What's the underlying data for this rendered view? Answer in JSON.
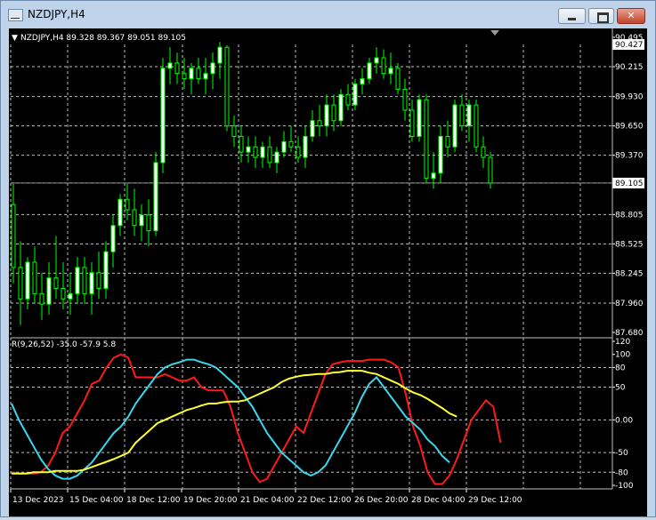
{
  "window": {
    "title": "NZDJPY,H4",
    "controls": {
      "minimize": "▁",
      "maximize": "□",
      "close": "✕"
    }
  },
  "chart_header": {
    "arrow": "▼",
    "symbol_info": "NZDJPY,H4  89.328 89.367 89.051 89.105"
  },
  "indicator_header": "R(9,26,52) -35.0 -57.9 5.8",
  "price_labels": {
    "bid_tag": "90.427",
    "current_tag": "89.105"
  },
  "colors": {
    "background": "#000000",
    "grid": "#bfbfbf",
    "candle": "#00ff00",
    "candle_fill": "#ffffff",
    "line_red": "#ff1a1a",
    "line_cyan": "#39d8ee",
    "line_yellow": "#ffff33"
  },
  "chart_data": [
    {
      "type": "candlestick",
      "title": "NZDJPY,H4",
      "ylim": [
        87.68,
        90.495
      ],
      "y_ticks": [
        "90.495",
        "90.215",
        "89.930",
        "89.650",
        "89.370",
        "89.105",
        "88.805",
        "88.525",
        "88.245",
        "87.960",
        "87.680"
      ],
      "current_price": 89.105,
      "candles": [
        {
          "o": 88.9,
          "h": 89.1,
          "l": 88.15,
          "c": 88.3
        },
        {
          "o": 88.3,
          "h": 88.55,
          "l": 87.75,
          "c": 88.0
        },
        {
          "o": 88.0,
          "h": 88.4,
          "l": 87.9,
          "c": 88.35
        },
        {
          "o": 88.35,
          "h": 88.5,
          "l": 87.95,
          "c": 88.05
        },
        {
          "o": 88.05,
          "h": 88.25,
          "l": 87.8,
          "c": 87.95
        },
        {
          "o": 87.95,
          "h": 88.35,
          "l": 87.85,
          "c": 88.2
        },
        {
          "o": 88.2,
          "h": 88.6,
          "l": 88.0,
          "c": 88.1
        },
        {
          "o": 88.1,
          "h": 88.35,
          "l": 87.9,
          "c": 88.0
        },
        {
          "o": 88.0,
          "h": 88.25,
          "l": 87.85,
          "c": 88.05
        },
        {
          "o": 88.05,
          "h": 88.4,
          "l": 87.95,
          "c": 88.3
        },
        {
          "o": 88.3,
          "h": 88.4,
          "l": 87.95,
          "c": 88.05
        },
        {
          "o": 88.05,
          "h": 88.35,
          "l": 87.85,
          "c": 88.25
        },
        {
          "o": 88.25,
          "h": 88.45,
          "l": 88.0,
          "c": 88.1
        },
        {
          "o": 88.1,
          "h": 88.55,
          "l": 88.0,
          "c": 88.45
        },
        {
          "o": 88.45,
          "h": 88.8,
          "l": 88.3,
          "c": 88.7
        },
        {
          "o": 88.7,
          "h": 89.0,
          "l": 88.6,
          "c": 88.95
        },
        {
          "o": 88.95,
          "h": 89.1,
          "l": 88.75,
          "c": 88.85
        },
        {
          "o": 88.85,
          "h": 89.05,
          "l": 88.6,
          "c": 88.7
        },
        {
          "o": 88.7,
          "h": 88.9,
          "l": 88.55,
          "c": 88.8
        },
        {
          "o": 88.8,
          "h": 88.95,
          "l": 88.5,
          "c": 88.65
        },
        {
          "o": 88.65,
          "h": 89.4,
          "l": 88.6,
          "c": 89.3
        },
        {
          "o": 89.3,
          "h": 90.3,
          "l": 89.2,
          "c": 90.2
        },
        {
          "o": 90.2,
          "h": 90.4,
          "l": 90.05,
          "c": 90.25
        },
        {
          "o": 90.25,
          "h": 90.35,
          "l": 90.05,
          "c": 90.15
        },
        {
          "o": 90.15,
          "h": 90.3,
          "l": 90.0,
          "c": 90.1
        },
        {
          "o": 90.1,
          "h": 90.25,
          "l": 89.95,
          "c": 90.2
        },
        {
          "o": 90.2,
          "h": 90.3,
          "l": 90.05,
          "c": 90.1
        },
        {
          "o": 90.1,
          "h": 90.3,
          "l": 89.95,
          "c": 90.15
        },
        {
          "o": 90.15,
          "h": 90.35,
          "l": 90.0,
          "c": 90.25
        },
        {
          "o": 90.25,
          "h": 90.45,
          "l": 90.1,
          "c": 90.4
        },
        {
          "o": 90.4,
          "h": 90.42,
          "l": 89.6,
          "c": 89.65
        },
        {
          "o": 89.65,
          "h": 89.75,
          "l": 89.45,
          "c": 89.55
        },
        {
          "o": 89.55,
          "h": 89.65,
          "l": 89.3,
          "c": 89.4
        },
        {
          "o": 89.4,
          "h": 89.55,
          "l": 89.3,
          "c": 89.45
        },
        {
          "o": 89.45,
          "h": 89.55,
          "l": 89.25,
          "c": 89.35
        },
        {
          "o": 89.35,
          "h": 89.5,
          "l": 89.25,
          "c": 89.45
        },
        {
          "o": 89.45,
          "h": 89.55,
          "l": 89.25,
          "c": 89.3
        },
        {
          "o": 89.3,
          "h": 89.45,
          "l": 89.2,
          "c": 89.4
        },
        {
          "o": 89.4,
          "h": 89.6,
          "l": 89.35,
          "c": 89.5
        },
        {
          "o": 89.5,
          "h": 89.65,
          "l": 89.4,
          "c": 89.45
        },
        {
          "o": 89.45,
          "h": 89.55,
          "l": 89.3,
          "c": 89.35
        },
        {
          "o": 89.35,
          "h": 89.65,
          "l": 89.25,
          "c": 89.55
        },
        {
          "o": 89.55,
          "h": 89.8,
          "l": 89.5,
          "c": 89.7
        },
        {
          "o": 89.7,
          "h": 89.85,
          "l": 89.55,
          "c": 89.65
        },
        {
          "o": 89.65,
          "h": 89.95,
          "l": 89.55,
          "c": 89.85
        },
        {
          "o": 89.85,
          "h": 89.95,
          "l": 89.6,
          "c": 89.7
        },
        {
          "o": 89.7,
          "h": 90.0,
          "l": 89.65,
          "c": 89.95
        },
        {
          "o": 89.95,
          "h": 90.05,
          "l": 89.8,
          "c": 89.85
        },
        {
          "o": 89.85,
          "h": 90.1,
          "l": 89.8,
          "c": 90.05
        },
        {
          "o": 90.05,
          "h": 90.2,
          "l": 89.95,
          "c": 90.1
        },
        {
          "o": 90.1,
          "h": 90.3,
          "l": 90.05,
          "c": 90.25
        },
        {
          "o": 90.25,
          "h": 90.4,
          "l": 90.15,
          "c": 90.3
        },
        {
          "o": 90.3,
          "h": 90.38,
          "l": 90.1,
          "c": 90.15
        },
        {
          "o": 90.15,
          "h": 90.35,
          "l": 90.05,
          "c": 90.2
        },
        {
          "o": 90.2,
          "h": 90.25,
          "l": 89.95,
          "c": 90.0
        },
        {
          "o": 90.0,
          "h": 90.1,
          "l": 89.7,
          "c": 89.8
        },
        {
          "o": 89.8,
          "h": 89.9,
          "l": 89.5,
          "c": 89.55
        },
        {
          "o": 89.55,
          "h": 89.95,
          "l": 89.5,
          "c": 89.9
        },
        {
          "o": 89.9,
          "h": 89.95,
          "l": 89.1,
          "c": 89.15
        },
        {
          "o": 89.15,
          "h": 89.4,
          "l": 89.05,
          "c": 89.2
        },
        {
          "o": 89.2,
          "h": 89.65,
          "l": 89.1,
          "c": 89.55
        },
        {
          "o": 89.55,
          "h": 89.7,
          "l": 89.35,
          "c": 89.45
        },
        {
          "o": 89.45,
          "h": 89.9,
          "l": 89.4,
          "c": 89.85
        },
        {
          "o": 89.85,
          "h": 89.95,
          "l": 89.6,
          "c": 89.65
        },
        {
          "o": 89.65,
          "h": 89.9,
          "l": 89.5,
          "c": 89.85
        },
        {
          "o": 89.85,
          "h": 89.9,
          "l": 89.4,
          "c": 89.45
        },
        {
          "o": 89.45,
          "h": 89.55,
          "l": 89.25,
          "c": 89.35
        },
        {
          "o": 89.35,
          "h": 89.4,
          "l": 89.051,
          "c": 89.105
        }
      ]
    },
    {
      "type": "line",
      "title": "R(9,26,52) -35.0 -57.9 5.8",
      "ylim": [
        -100,
        120
      ],
      "y_ticks": [
        "120",
        "100",
        "80",
        "50",
        "0.00",
        "-50",
        "-80",
        "-100"
      ],
      "x_tick_labels": [
        "13 Dec 2023",
        "15 Dec 04:00",
        "18 Dec 12:00",
        "19 Dec 20:00",
        "21 Dec 04:00",
        "22 Dec 12:00",
        "26 Dec 20:00",
        "28 Dec 04:00",
        "29 Dec 12:00"
      ],
      "series": [
        {
          "color_key": "line_red",
          "values": [
            -80,
            -82,
            -82,
            -82,
            -80,
            -70,
            -50,
            -20,
            -10,
            10,
            30,
            55,
            60,
            80,
            95,
            100,
            95,
            65,
            65,
            65,
            65,
            70,
            65,
            60,
            60,
            65,
            50,
            45,
            45,
            45,
            20,
            -20,
            -50,
            -80,
            -95,
            -90,
            -70,
            -50,
            -30,
            -10,
            -20,
            10,
            40,
            70,
            85,
            88,
            90,
            90,
            90,
            92,
            92,
            92,
            88,
            80,
            40,
            -10,
            -40,
            -80,
            -98,
            -98,
            -85,
            -60,
            -30,
            0,
            15,
            30,
            20,
            -35
          ]
        },
        {
          "color_key": "line_cyan",
          "values": [
            25,
            0,
            -20,
            -40,
            -60,
            -75,
            -85,
            -90,
            -90,
            -85,
            -75,
            -65,
            -50,
            -35,
            -20,
            -10,
            5,
            25,
            40,
            55,
            70,
            80,
            85,
            88,
            92,
            92,
            88,
            85,
            80,
            70,
            60,
            50,
            35,
            20,
            0,
            -20,
            -35,
            -50,
            -60,
            -70,
            -80,
            -85,
            -80,
            -70,
            -50,
            -30,
            -10,
            10,
            35,
            55,
            65,
            50,
            35,
            20,
            5,
            -5,
            -15,
            -30,
            -40,
            -55,
            -65
          ]
        },
        {
          "color_key": "line_yellow",
          "values": [
            -82,
            -82,
            -82,
            -80,
            -80,
            -80,
            -78,
            -78,
            -78,
            -78,
            -76,
            -72,
            -68,
            -64,
            -60,
            -55,
            -50,
            -35,
            -25,
            -15,
            -5,
            0,
            5,
            10,
            15,
            18,
            22,
            25,
            25,
            27,
            28,
            28,
            30,
            35,
            40,
            45,
            50,
            58,
            63,
            66,
            68,
            69,
            70,
            70,
            72,
            73,
            75,
            75,
            75,
            72,
            70,
            65,
            60,
            55,
            48,
            42,
            38,
            32,
            25,
            18,
            10,
            5
          ]
        }
      ]
    }
  ]
}
